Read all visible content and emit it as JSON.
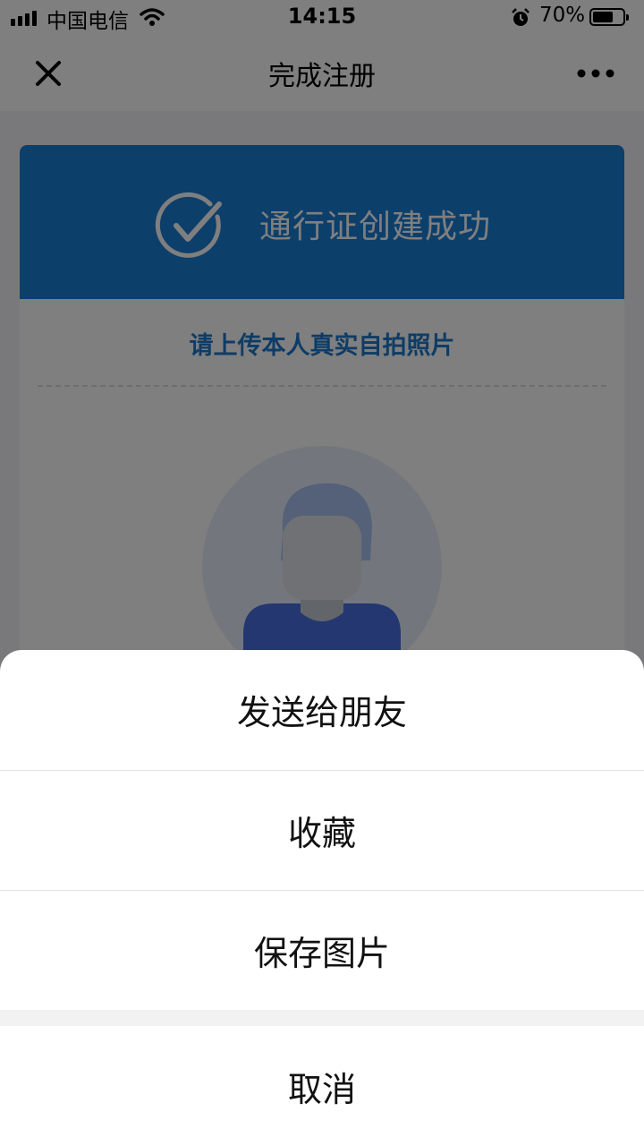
{
  "status_bar": {
    "carrier": "中国电信",
    "time": "14:15",
    "battery_percent": "70%",
    "battery_level": 0.7,
    "icons": [
      "signal-icon",
      "wifi-icon",
      "alarm-icon",
      "battery-icon"
    ]
  },
  "nav": {
    "title": "完成注册",
    "close_icon": "close-icon",
    "more_icon": "more-icon"
  },
  "card": {
    "success_text": "通行证创建成功",
    "upload_hint": "请上传本人真实自拍照片",
    "header_color": "#1a7fd6",
    "hint_color": "#1f78cc"
  },
  "action_sheet": {
    "items": [
      {
        "label": "发送给朋友"
      },
      {
        "label": "收藏"
      },
      {
        "label": "保存图片"
      }
    ],
    "cancel_label": "取消"
  }
}
